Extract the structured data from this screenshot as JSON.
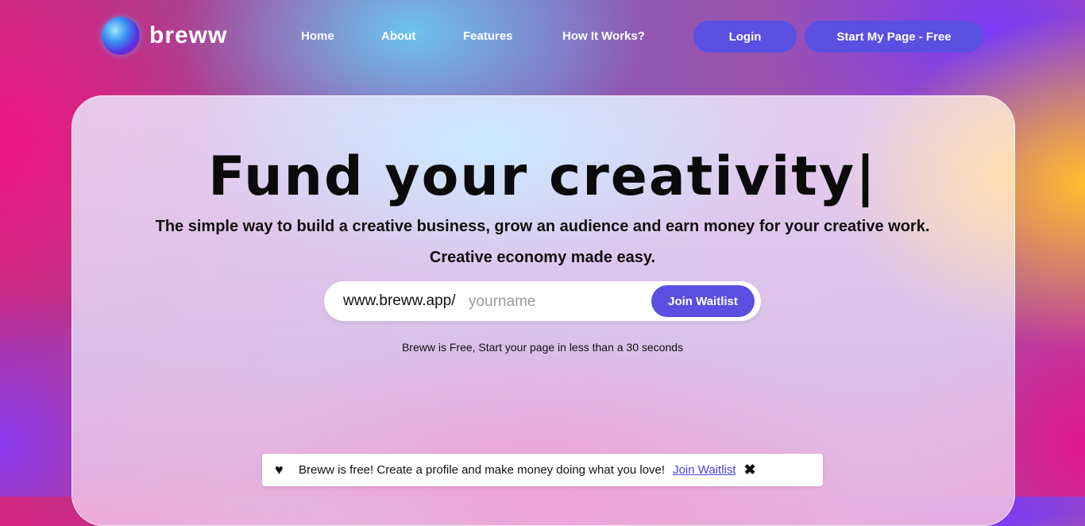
{
  "header": {
    "brand": "breww",
    "nav": [
      "Home",
      "About",
      "Features",
      "How It Works?"
    ],
    "login_label": "Login",
    "start_label": "Start My Page - Free"
  },
  "hero": {
    "title": "Fund your creativity|",
    "subtitle": "The simple way to build a creative business, grow an audience and earn money for your creative work.",
    "subtitle2": "Creative economy made easy.",
    "signup": {
      "prefix": "www.breww.app/",
      "placeholder": "yourname",
      "button_label": "Join Waitlist"
    },
    "note": "Breww is Free, Start your page in less than a 30 seconds"
  },
  "banner": {
    "icon": "heart-icon",
    "text": "Breww is free!  Create a profile and make money doing what you love!",
    "link_label": " Join Waitlist",
    "close_icon": "close-icon"
  },
  "colors": {
    "accent": "#5a4fe0"
  }
}
